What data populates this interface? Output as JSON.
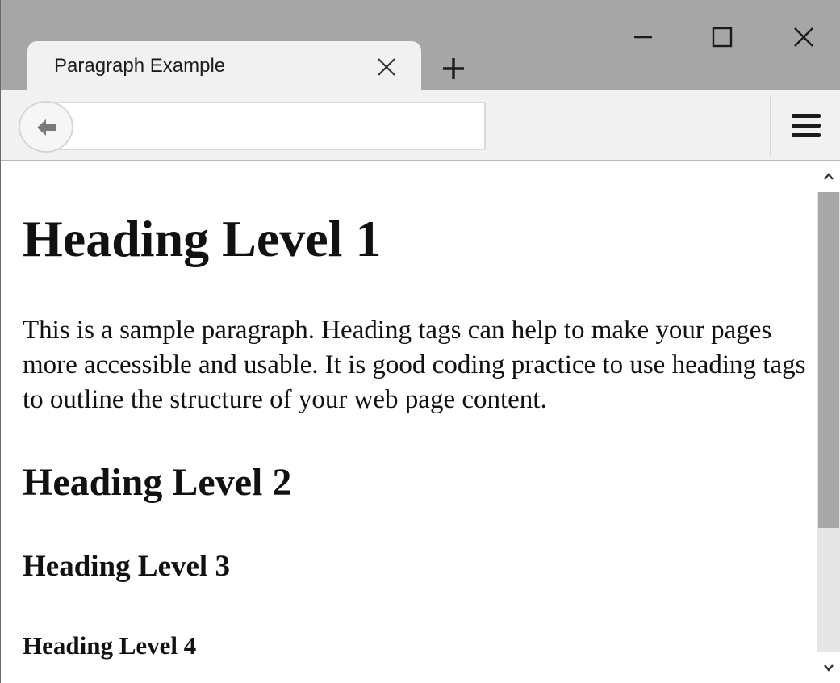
{
  "window": {
    "tab_title": "Paragraph Example",
    "icons": {
      "tab_close": "close-icon",
      "new_tab": "plus-icon",
      "minimize": "minimize-icon",
      "maximize": "maximize-icon",
      "close": "close-icon",
      "back": "back-arrow-icon",
      "menu": "hamburger-menu-icon",
      "scroll_up": "chevron-up-icon",
      "scroll_down": "chevron-down-icon"
    }
  },
  "navbar": {
    "url_value": ""
  },
  "page": {
    "h1": "Heading Level 1",
    "paragraph": "This is a sample paragraph. Heading tags can help to make your pages more accessible and usable. It is good coding practice to use heading tags to outline the structure of your web page content.",
    "h2": "Heading Level 2",
    "h3": "Heading Level 3",
    "h4": "Heading Level 4"
  },
  "scroll": {
    "position_fraction": 0.0,
    "visible_fraction": 0.73
  },
  "colors": {
    "titlebar": "#a6a6a6",
    "toolbar": "#f1f1f1",
    "scroll_thumb": "#a8a8a8"
  }
}
